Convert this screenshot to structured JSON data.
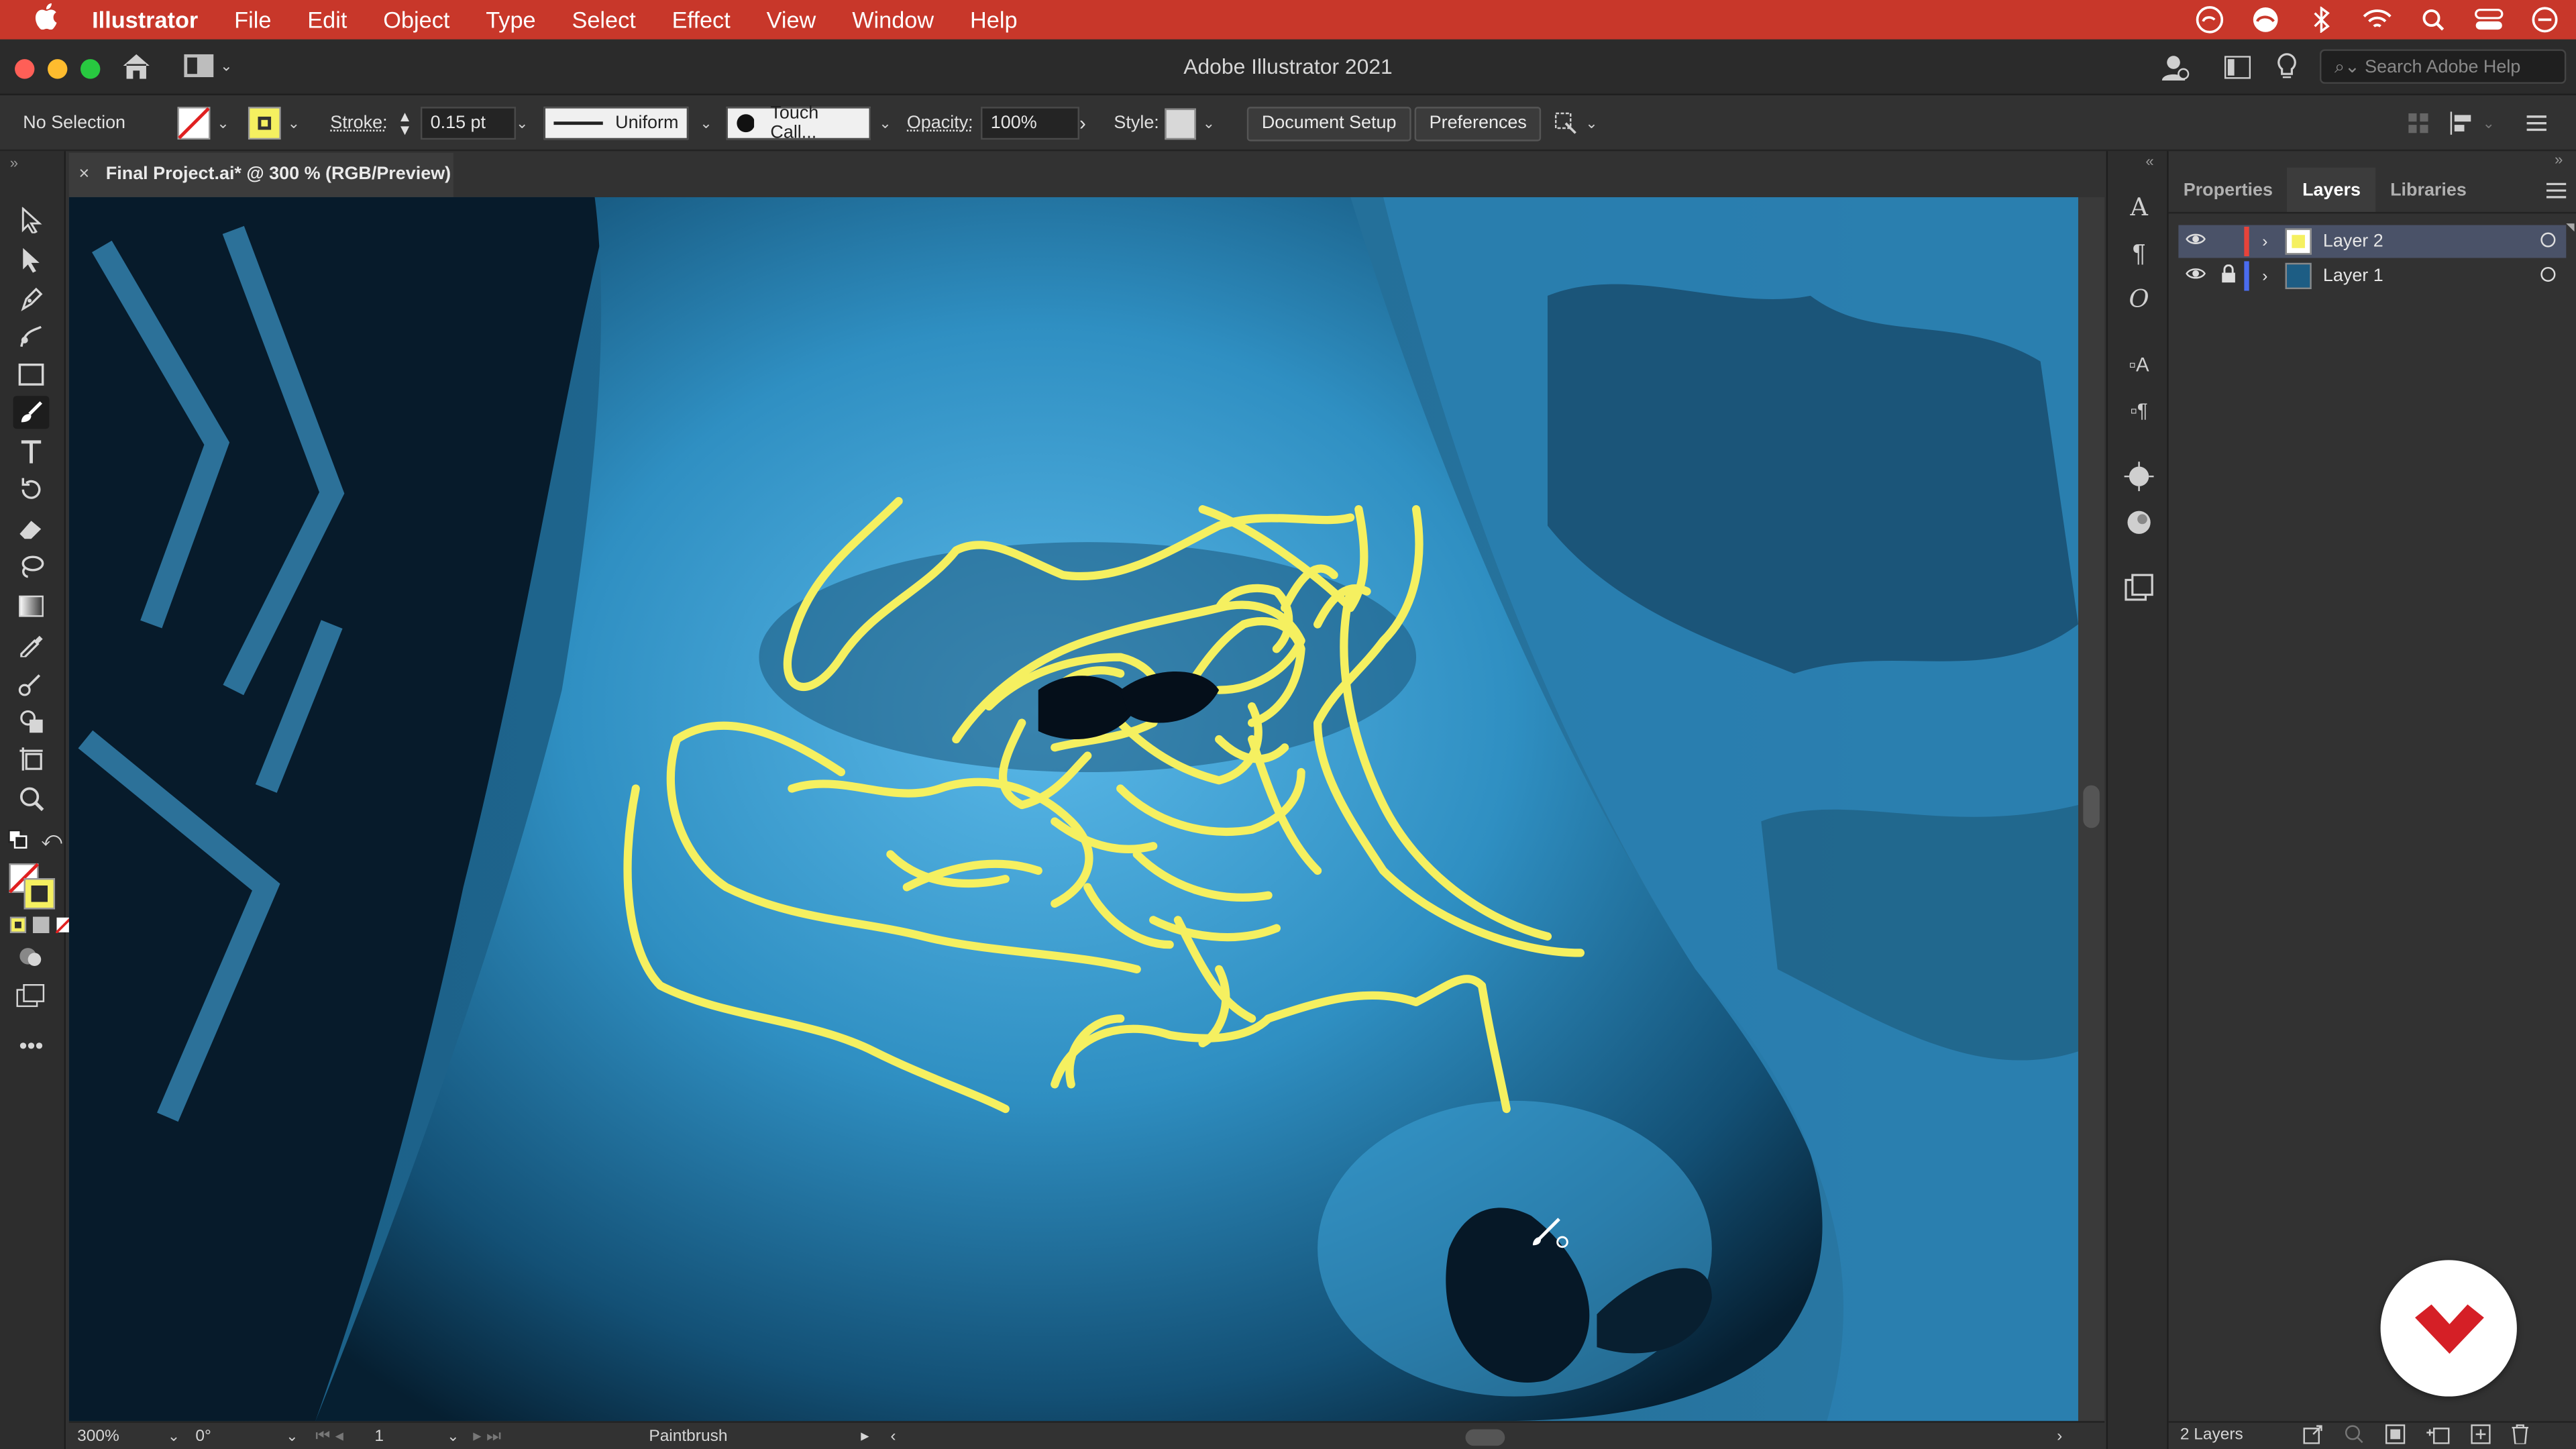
{
  "menubar": {
    "app": "Illustrator",
    "items": [
      "File",
      "Edit",
      "Object",
      "Type",
      "Select",
      "Effect",
      "View",
      "Window",
      "Help"
    ]
  },
  "window": {
    "title": "Adobe Illustrator 2021",
    "search_placeholder": "Search Adobe Help"
  },
  "control": {
    "selection": "No Selection",
    "stroke_label": "Stroke:",
    "stroke_value": "0.15 pt",
    "profile": "Uniform",
    "brush": "Touch Call...",
    "opacity_label": "Opacity:",
    "opacity_value": "100%",
    "style_label": "Style:",
    "document_setup": "Document Setup",
    "preferences": "Preferences"
  },
  "document": {
    "tab_title": "Final Project.ai* @ 300 % (RGB/Preview)"
  },
  "status": {
    "zoom": "300%",
    "rotation": "0°",
    "artboard": "1",
    "tool": "Paintbrush"
  },
  "panel": {
    "tabs": [
      "Properties",
      "Layers",
      "Libraries"
    ],
    "active_tab": "Layers",
    "layers": [
      {
        "name": "Layer 2",
        "color": "#e8433a",
        "locked": false,
        "selected": true
      },
      {
        "name": "Layer 1",
        "color": "#4a6cf0",
        "locked": true,
        "selected": false
      }
    ],
    "footer": "2 Layers"
  },
  "colors": {
    "menubar": "#c8372a",
    "stroke_yellow": "#f5f060",
    "canvas_blue": "#2d88b8",
    "logo_red": "#d51f26"
  }
}
